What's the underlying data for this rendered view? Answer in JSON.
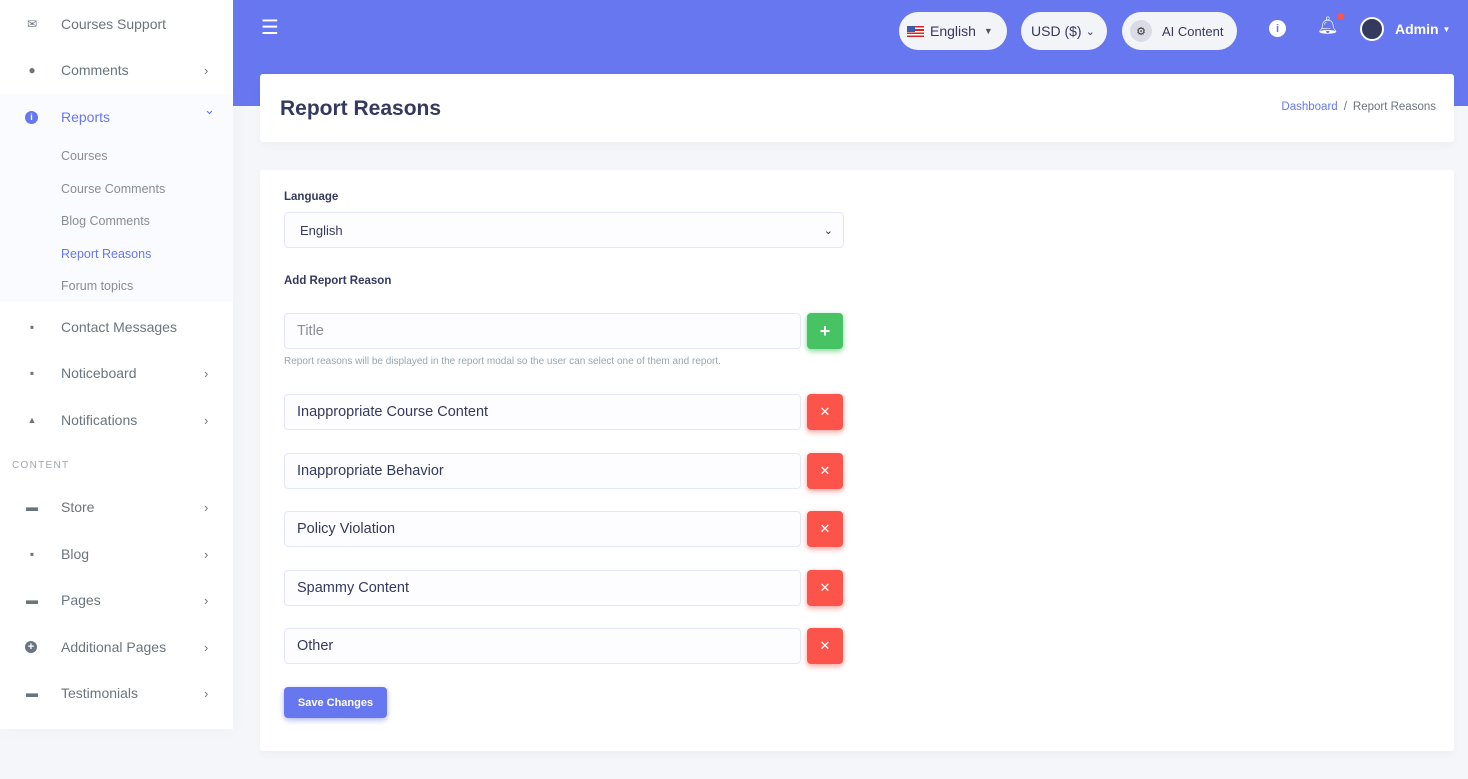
{
  "sidebar": {
    "items_top": [
      {
        "label": "Courses Support",
        "icon": "envelope-open-icon",
        "glyph": "✉",
        "chevron": ""
      },
      {
        "label": "Comments",
        "icon": "comments-icon",
        "glyph": "●",
        "chevron": "›"
      }
    ],
    "reports": {
      "label": "Reports",
      "icon": "info-circle-icon",
      "glyph": "i",
      "chevron": "⌄"
    },
    "reports_sub": [
      "Courses",
      "Course Comments",
      "Blog Comments",
      "Report Reasons",
      "Forum topics"
    ],
    "items_mid": [
      {
        "label": "Contact Messages",
        "icon": "message-square-icon",
        "glyph": "▪",
        "chevron": ""
      },
      {
        "label": "Noticeboard",
        "icon": "sticky-note-icon",
        "glyph": "▪",
        "chevron": "›"
      },
      {
        "label": "Notifications",
        "icon": "bell-icon",
        "glyph": "▲",
        "chevron": "›"
      }
    ],
    "section_header": "CONTENT",
    "items_content": [
      {
        "label": "Store",
        "icon": "store-icon",
        "glyph": "▬",
        "chevron": "›"
      },
      {
        "label": "Blog",
        "icon": "rss-icon",
        "glyph": "▪",
        "chevron": "›"
      },
      {
        "label": "Pages",
        "icon": "window-icon",
        "glyph": "▬",
        "chevron": "›"
      },
      {
        "label": "Additional Pages",
        "icon": "plus-circle-icon",
        "glyph": "+",
        "chevron": "›"
      },
      {
        "label": "Testimonials",
        "icon": "id-card-icon",
        "glyph": "▬",
        "chevron": "›"
      }
    ]
  },
  "topbar": {
    "language": "English",
    "currency": "USD ($)",
    "ai_content": "AI Content",
    "user": "Admin"
  },
  "header": {
    "title": "Report Reasons",
    "breadcrumb": [
      "Dashboard",
      "Report Reasons"
    ]
  },
  "form": {
    "language_label": "Language",
    "language_value": "English",
    "add_label": "Add Report Reason",
    "title_placeholder": "Title",
    "help_text": "Report reasons will be displayed in the report modal so the user can select one of them and report.",
    "reasons": [
      "Inappropriate Course Content",
      "Inappropriate Behavior",
      "Policy Violation",
      "Spammy Content",
      "Other"
    ],
    "save_label": "Save Changes"
  },
  "colors": {
    "primary": "#6777ef",
    "success": "#47c363",
    "danger": "#fc544b"
  }
}
